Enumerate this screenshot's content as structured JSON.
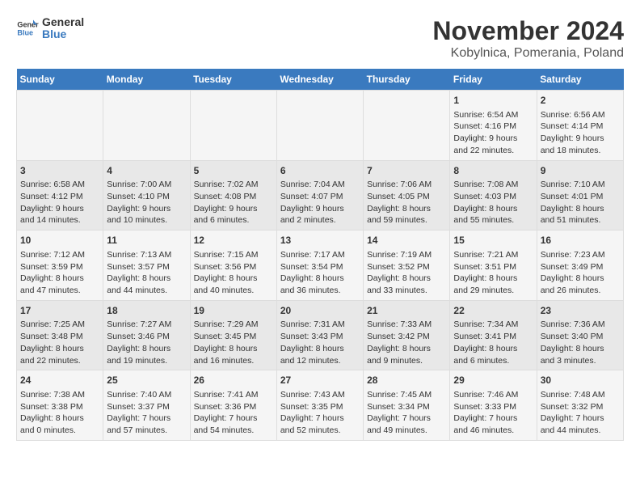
{
  "header": {
    "logo_general": "General",
    "logo_blue": "Blue",
    "title": "November 2024",
    "subtitle": "Kobylnica, Pomerania, Poland"
  },
  "days_of_week": [
    "Sunday",
    "Monday",
    "Tuesday",
    "Wednesday",
    "Thursday",
    "Friday",
    "Saturday"
  ],
  "weeks": [
    [
      {
        "day": "",
        "info": ""
      },
      {
        "day": "",
        "info": ""
      },
      {
        "day": "",
        "info": ""
      },
      {
        "day": "",
        "info": ""
      },
      {
        "day": "",
        "info": ""
      },
      {
        "day": "1",
        "info": "Sunrise: 6:54 AM\nSunset: 4:16 PM\nDaylight: 9 hours and 22 minutes."
      },
      {
        "day": "2",
        "info": "Sunrise: 6:56 AM\nSunset: 4:14 PM\nDaylight: 9 hours and 18 minutes."
      }
    ],
    [
      {
        "day": "3",
        "info": "Sunrise: 6:58 AM\nSunset: 4:12 PM\nDaylight: 9 hours and 14 minutes."
      },
      {
        "day": "4",
        "info": "Sunrise: 7:00 AM\nSunset: 4:10 PM\nDaylight: 9 hours and 10 minutes."
      },
      {
        "day": "5",
        "info": "Sunrise: 7:02 AM\nSunset: 4:08 PM\nDaylight: 9 hours and 6 minutes."
      },
      {
        "day": "6",
        "info": "Sunrise: 7:04 AM\nSunset: 4:07 PM\nDaylight: 9 hours and 2 minutes."
      },
      {
        "day": "7",
        "info": "Sunrise: 7:06 AM\nSunset: 4:05 PM\nDaylight: 8 hours and 59 minutes."
      },
      {
        "day": "8",
        "info": "Sunrise: 7:08 AM\nSunset: 4:03 PM\nDaylight: 8 hours and 55 minutes."
      },
      {
        "day": "9",
        "info": "Sunrise: 7:10 AM\nSunset: 4:01 PM\nDaylight: 8 hours and 51 minutes."
      }
    ],
    [
      {
        "day": "10",
        "info": "Sunrise: 7:12 AM\nSunset: 3:59 PM\nDaylight: 8 hours and 47 minutes."
      },
      {
        "day": "11",
        "info": "Sunrise: 7:13 AM\nSunset: 3:57 PM\nDaylight: 8 hours and 44 minutes."
      },
      {
        "day": "12",
        "info": "Sunrise: 7:15 AM\nSunset: 3:56 PM\nDaylight: 8 hours and 40 minutes."
      },
      {
        "day": "13",
        "info": "Sunrise: 7:17 AM\nSunset: 3:54 PM\nDaylight: 8 hours and 36 minutes."
      },
      {
        "day": "14",
        "info": "Sunrise: 7:19 AM\nSunset: 3:52 PM\nDaylight: 8 hours and 33 minutes."
      },
      {
        "day": "15",
        "info": "Sunrise: 7:21 AM\nSunset: 3:51 PM\nDaylight: 8 hours and 29 minutes."
      },
      {
        "day": "16",
        "info": "Sunrise: 7:23 AM\nSunset: 3:49 PM\nDaylight: 8 hours and 26 minutes."
      }
    ],
    [
      {
        "day": "17",
        "info": "Sunrise: 7:25 AM\nSunset: 3:48 PM\nDaylight: 8 hours and 22 minutes."
      },
      {
        "day": "18",
        "info": "Sunrise: 7:27 AM\nSunset: 3:46 PM\nDaylight: 8 hours and 19 minutes."
      },
      {
        "day": "19",
        "info": "Sunrise: 7:29 AM\nSunset: 3:45 PM\nDaylight: 8 hours and 16 minutes."
      },
      {
        "day": "20",
        "info": "Sunrise: 7:31 AM\nSunset: 3:43 PM\nDaylight: 8 hours and 12 minutes."
      },
      {
        "day": "21",
        "info": "Sunrise: 7:33 AM\nSunset: 3:42 PM\nDaylight: 8 hours and 9 minutes."
      },
      {
        "day": "22",
        "info": "Sunrise: 7:34 AM\nSunset: 3:41 PM\nDaylight: 8 hours and 6 minutes."
      },
      {
        "day": "23",
        "info": "Sunrise: 7:36 AM\nSunset: 3:40 PM\nDaylight: 8 hours and 3 minutes."
      }
    ],
    [
      {
        "day": "24",
        "info": "Sunrise: 7:38 AM\nSunset: 3:38 PM\nDaylight: 8 hours and 0 minutes."
      },
      {
        "day": "25",
        "info": "Sunrise: 7:40 AM\nSunset: 3:37 PM\nDaylight: 7 hours and 57 minutes."
      },
      {
        "day": "26",
        "info": "Sunrise: 7:41 AM\nSunset: 3:36 PM\nDaylight: 7 hours and 54 minutes."
      },
      {
        "day": "27",
        "info": "Sunrise: 7:43 AM\nSunset: 3:35 PM\nDaylight: 7 hours and 52 minutes."
      },
      {
        "day": "28",
        "info": "Sunrise: 7:45 AM\nSunset: 3:34 PM\nDaylight: 7 hours and 49 minutes."
      },
      {
        "day": "29",
        "info": "Sunrise: 7:46 AM\nSunset: 3:33 PM\nDaylight: 7 hours and 46 minutes."
      },
      {
        "day": "30",
        "info": "Sunrise: 7:48 AM\nSunset: 3:32 PM\nDaylight: 7 hours and 44 minutes."
      }
    ]
  ]
}
